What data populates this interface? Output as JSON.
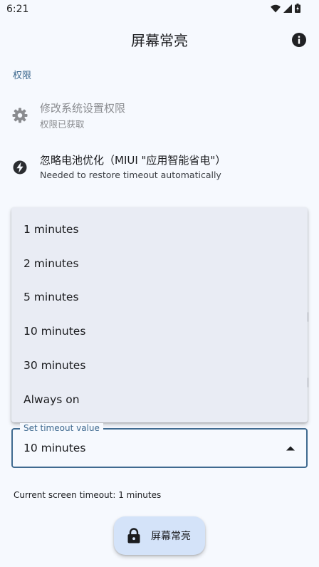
{
  "status_bar": {
    "time": "6:21",
    "icons": [
      "wifi-icon",
      "signal-icon",
      "battery-icon"
    ]
  },
  "app_bar": {
    "title": "屏幕常亮",
    "info_icon": "info-icon"
  },
  "permissions": {
    "section_title": "权限",
    "items": [
      {
        "icon": "gear-icon",
        "title": "修改系统设置权限",
        "subtitle": "权限已获取"
      },
      {
        "icon": "battery-saver-icon",
        "title": "忽略电池优化（MIUI \"应用智能省电\"）",
        "subtitle": "Needed to restore timeout automatically"
      }
    ]
  },
  "timeout_menu": {
    "options": [
      "1 minutes",
      "2 minutes",
      "5 minutes",
      "10 minutes",
      "30 minutes",
      "Always on"
    ]
  },
  "timeout_field": {
    "label": "Set timeout value",
    "value": "10 minutes",
    "expanded": true
  },
  "current_timeout_text": "Current screen timeout: 1 minutes",
  "fab": {
    "label": "屏幕常亮",
    "icon": "lock-icon"
  },
  "colors": {
    "background": "#f6f9fe",
    "accent": "#3f6a90",
    "menu_background": "#e9ecf4",
    "fab_background": "#d4e3f9"
  }
}
